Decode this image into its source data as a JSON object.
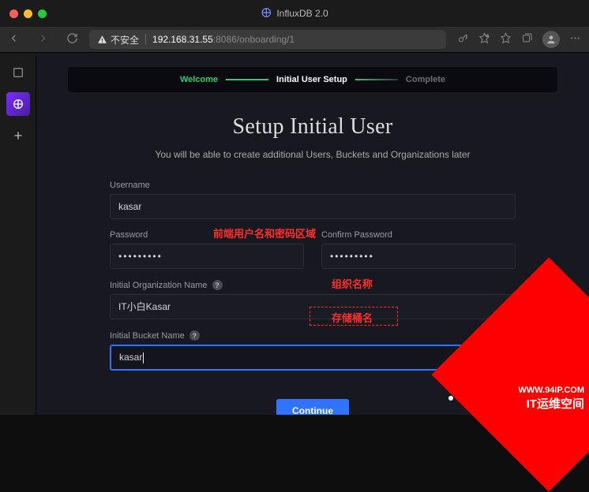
{
  "window": {
    "title": "InfluxDB 2.0"
  },
  "browser": {
    "insecure_label": "不安全",
    "host": "192.168.31.55",
    "port_path": ":8086/onboarding/1"
  },
  "stepper": {
    "welcome": "Welcome",
    "initial": "Initial User Setup",
    "complete": "Complete"
  },
  "page": {
    "heading": "Setup Initial User",
    "subtitle": "You will be able to create additional Users, Buckets and Organizations later"
  },
  "form": {
    "username_label": "Username",
    "username_value": "kasar",
    "password_label": "Password",
    "password_value": "•••••••••",
    "confirm_label": "Confirm Password",
    "confirm_value": "•••••••••",
    "org_label": "Initial Organization Name",
    "org_value": "IT小白Kasar",
    "bucket_label": "Initial Bucket Name",
    "bucket_value": "kasar",
    "help_glyph": "?",
    "continue_label": "Continue"
  },
  "annotations": {
    "credentials": "前端用户名和密码区域",
    "org_name": "组织名称",
    "bucket_name": "存储桶名"
  },
  "watermark": {
    "line1": "WWW.94IP.COM",
    "line2": "IT运维空间"
  }
}
